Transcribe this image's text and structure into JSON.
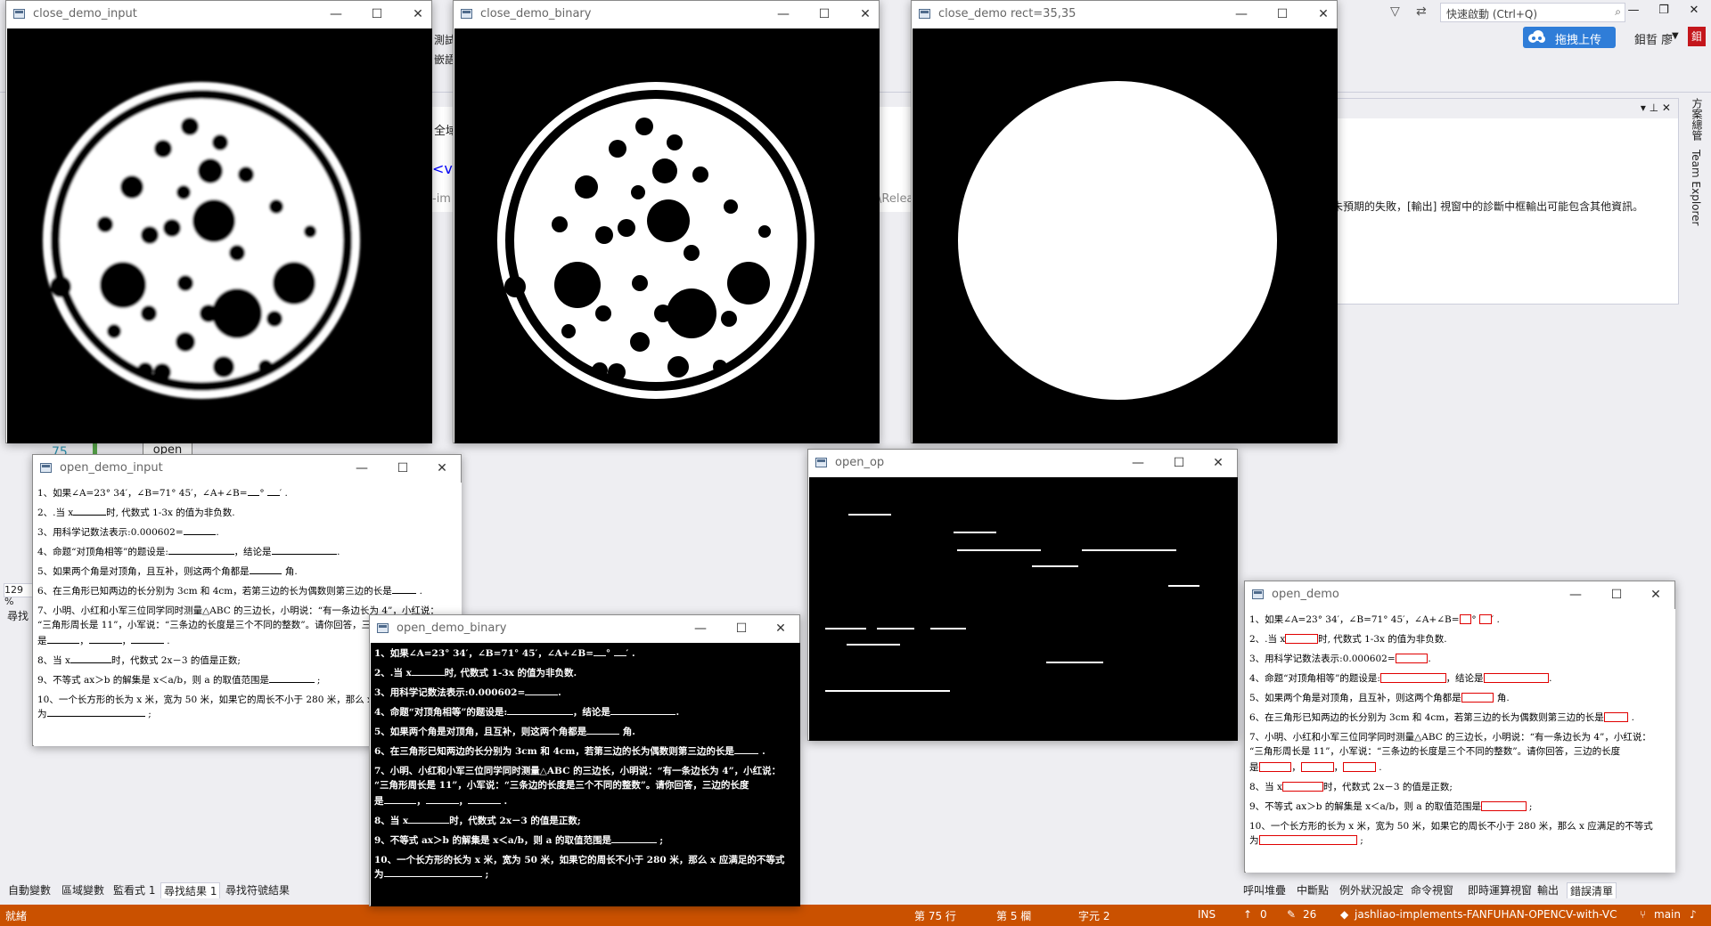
{
  "vs": {
    "quick_launch_placeholder": "快速啟動 (Ctrl+Q)",
    "upload_label": "拖拽上传",
    "user_name": "鉬晢 廖",
    "user_avatar": "鉬",
    "right_panel_message": "未預期的失敗，[輸出] 視窗中的診斷中框輸出可能包含其他資訊。",
    "vertical_tab_1": "方案總管",
    "vertical_tab_2": "Team Explorer",
    "mid_fragment_1": "全域",
    "mid_fragment_2": "<vc",
    "mid_fragment_3": "-im",
    "mid_fragment_4": "\\Relea",
    "mid_fragment_5": "測試",
    "mid_fragment_6": "嵌語",
    "line_number": "75",
    "code_peek": "open",
    "zoom": "129 %",
    "find_label": "尋找",
    "bottom_tabs_left": [
      "自動變數",
      "區域變數",
      "監看式 1",
      "尋找結果 1",
      "尋找符號結果"
    ],
    "bottom_tabs_left_active": 3,
    "bottom_tabs_right": [
      "呼叫堆疊",
      "中斷點",
      "例外狀況設定",
      "命令視窗",
      "即時運算視窗",
      "輸出",
      "錯誤清單"
    ],
    "bottom_tabs_right_active": 6
  },
  "statusbar": {
    "ready": "就緒",
    "line": "第 75 行",
    "col": "第 5 欄",
    "char": "字元 2",
    "ins": "INS",
    "up_count": "0",
    "pencil_count": "26",
    "repo": "jashliao-implements-FANFUHAN-OPENCV-with-VC",
    "branch": "main"
  },
  "windows": {
    "close_demo_input": {
      "title": "close_demo_input"
    },
    "close_demo_binary": {
      "title": "close_demo_binary"
    },
    "close_demo_rect": {
      "title": "close_demo rect=35,35"
    },
    "open_demo_input": {
      "title": "open_demo_input"
    },
    "open_demo_binary": {
      "title": "open_demo_binary"
    },
    "open_op": {
      "title": "open_op"
    },
    "open_demo": {
      "title": "open_demo"
    }
  },
  "doc_lines": [
    "1、如果∠A=23° 34′，∠B=71° 45′，∠A+∠B=___° ___′ .",
    "2、.当 x________时, 代数式 1-3x 的值为非负数.",
    "3、用科学记数法表示:0.000602=________.",
    "4、命题“对顶角相等”的题设是:________________，结论是________________.",
    "5、如果两个角是对顶角，且互补，则这两个角都是________ 角.",
    "6、在三角形已知两边的长分别为 3cm 和 4cm，若第三边的长为偶数则第三边的长是______ .",
    "7、小明、小红和小军三位同学同时测量△ABC 的三边长，小明说：“有一条边长为 4”，小红说：",
    "“三角形周长是 11”，小军说：“三条边的长度是三个不同的整数”。请你回答，三边的长度",
    "是________，________，________ .",
    "8、当 x__________时，代数式 2x－3 的值是正数;",
    "9、不等式 ax＞b 的解集是 x＜a/b，则 a 的取值范围是___________ ;",
    "10、一个长方形的长为 x 米，宽为 50 米，如果它的周长不小于 280 米，那么 x 应满足的不等式",
    "为________________________ ;"
  ]
}
